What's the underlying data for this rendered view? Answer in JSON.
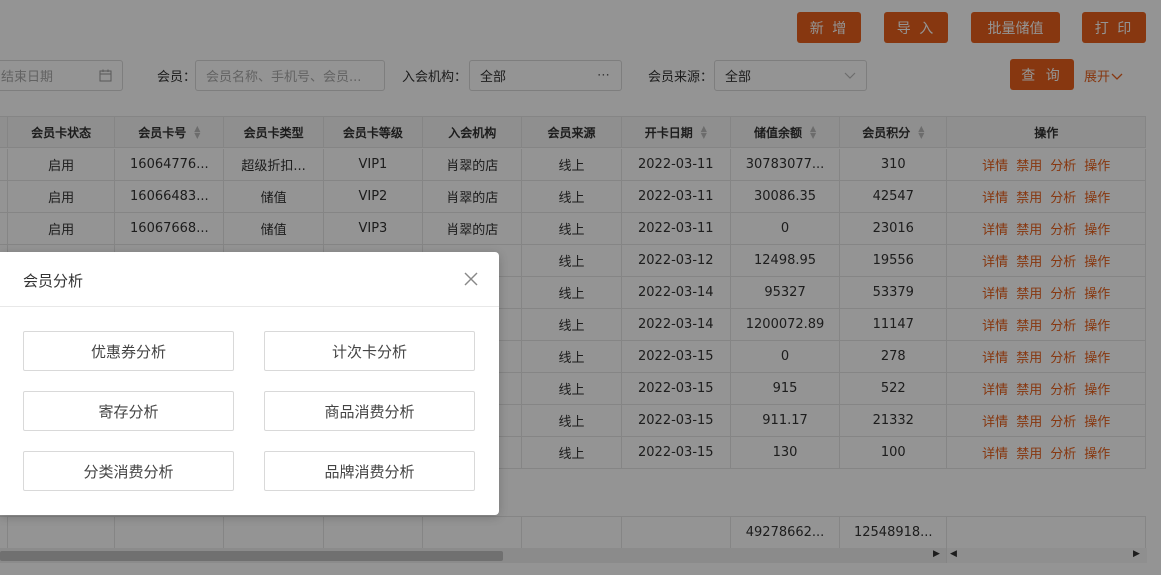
{
  "toolbar": {
    "add": "新 增",
    "import": "导 入",
    "batch_recharge": "批量储值",
    "print": "打 印"
  },
  "filters": {
    "end_date_placeholder": "结束日期",
    "member_label": "会员：",
    "member_placeholder": "会员名称、手机号、会员...",
    "org_label": "入会机构：",
    "org_value": "全部",
    "source_label": "会员来源：",
    "source_value": "全部",
    "query": "查 询",
    "expand": "展开"
  },
  "table": {
    "headers": [
      "会员卡状态",
      "会员卡号",
      "会员卡类型",
      "会员卡等级",
      "入会机构",
      "会员来源",
      "开卡日期",
      "储值余额",
      "会员积分",
      "操作"
    ],
    "rows": [
      [
        "启用",
        "16064776...",
        "超级折扣...",
        "VIP1",
        "肖翠的店",
        "线上",
        "2022-03-11",
        "30783077...",
        "310"
      ],
      [
        "启用",
        "16066483...",
        "储值",
        "VIP2",
        "肖翠的店",
        "线上",
        "2022-03-11",
        "30086.35",
        "42547"
      ],
      [
        "启用",
        "16067668...",
        "储值",
        "VIP3",
        "肖翠的店",
        "线上",
        "2022-03-11",
        "0",
        "23016"
      ],
      [
        "",
        "",
        "",
        "",
        "",
        "线上",
        "2022-03-12",
        "12498.95",
        "19556"
      ],
      [
        "",
        "",
        "",
        "",
        "",
        "线上",
        "2022-03-14",
        "95327",
        "53379"
      ],
      [
        "",
        "",
        "",
        "",
        "",
        "线上",
        "2022-03-14",
        "1200072.89",
        "11147"
      ],
      [
        "",
        "",
        "",
        "",
        "",
        "线上",
        "2022-03-15",
        "0",
        "278"
      ],
      [
        "",
        "",
        "",
        "",
        "",
        "线上",
        "2022-03-15",
        "915",
        "522"
      ],
      [
        "",
        "",
        "",
        "",
        "",
        "线上",
        "2022-03-15",
        "911.17",
        "21332"
      ],
      [
        "",
        "",
        "",
        "",
        "",
        "线上",
        "2022-03-15",
        "130",
        "100"
      ]
    ],
    "ops": [
      "详情",
      "禁用",
      "分析",
      "操作"
    ],
    "totals": {
      "balance": "49278662...",
      "points": "12548918..."
    }
  },
  "modal": {
    "title": "会员分析",
    "buttons": [
      "优惠券分析",
      "计次卡分析",
      "寄存分析",
      "商品消费分析",
      "分类消费分析",
      "品牌消费分析"
    ]
  },
  "colors": {
    "accent": "#e8601c"
  }
}
